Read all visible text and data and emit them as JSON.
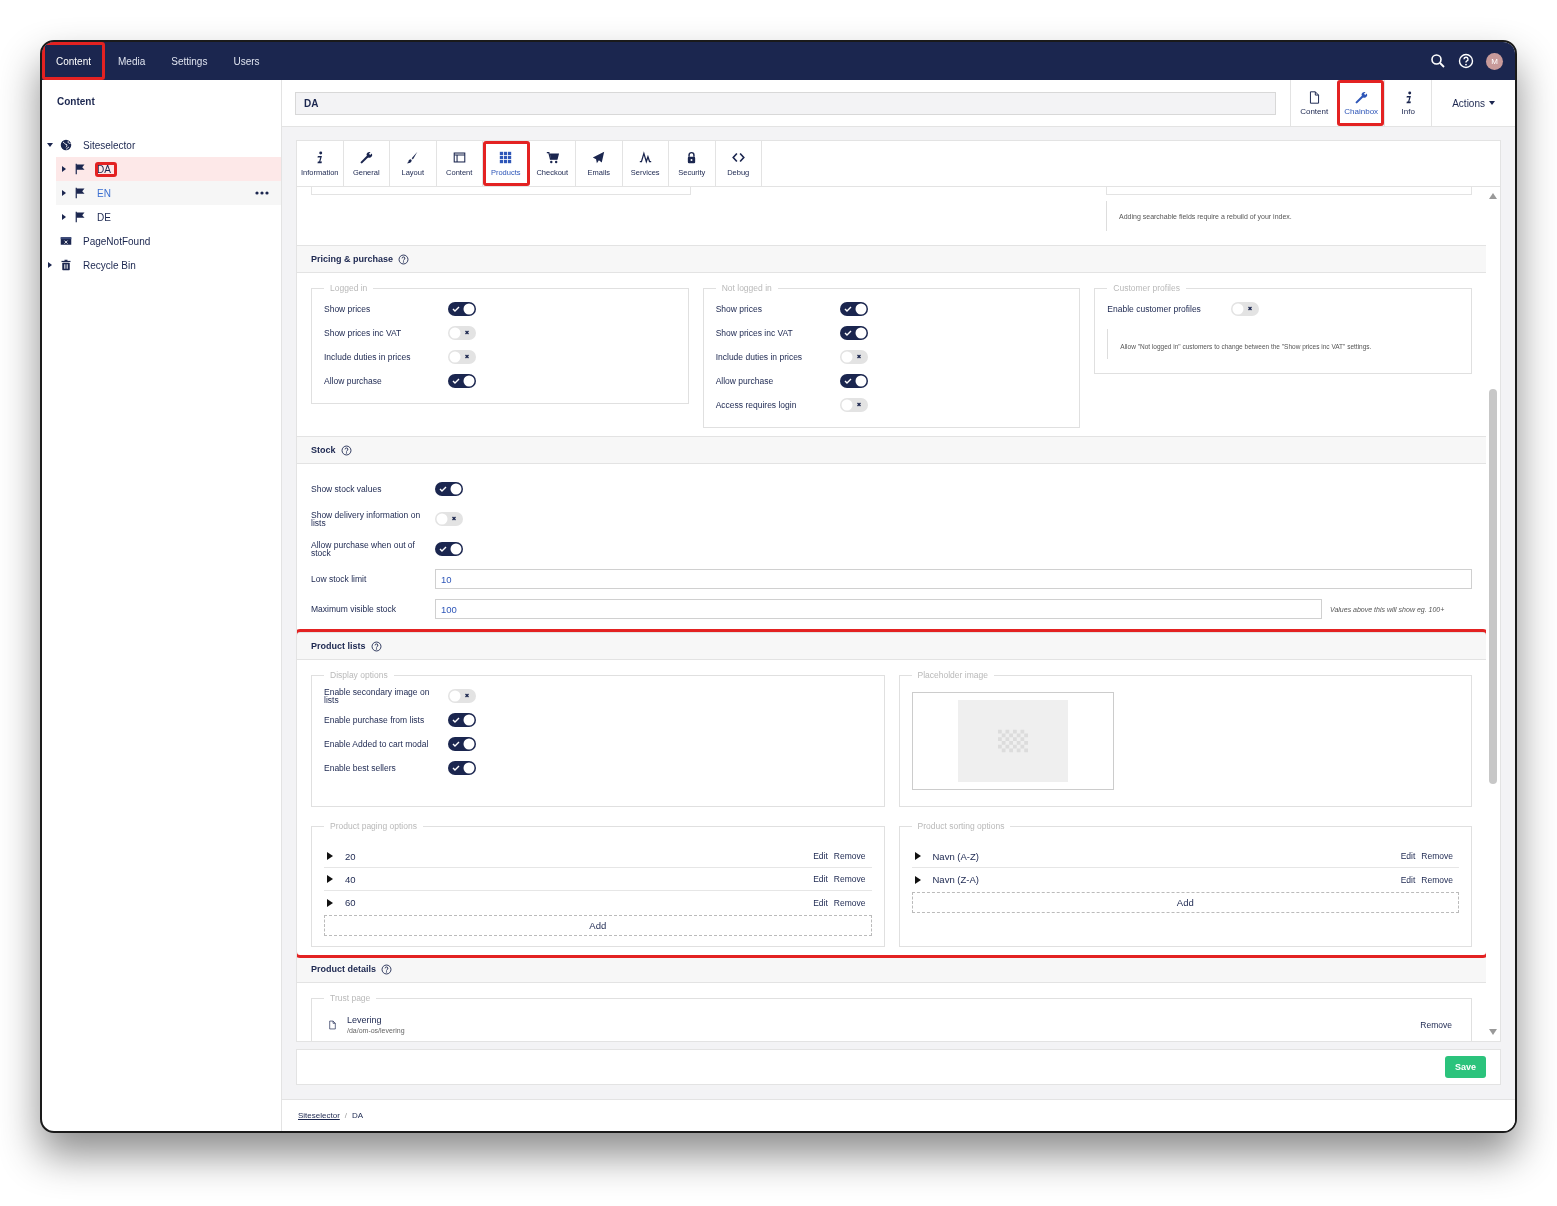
{
  "top_nav": {
    "items": [
      {
        "label": "Content",
        "selected": true,
        "highlighted": true
      },
      {
        "label": "Media",
        "selected": false,
        "highlighted": false
      },
      {
        "label": "Settings",
        "selected": false,
        "highlighted": false
      },
      {
        "label": "Users",
        "selected": false,
        "highlighted": false
      }
    ],
    "avatar": "M"
  },
  "sidebar": {
    "title": "Content",
    "tree": [
      {
        "label": "Siteselector",
        "kind": "site",
        "expanded": true,
        "selected": false,
        "hovered": false,
        "highlighted": false,
        "children": [
          {
            "label": "DA",
            "kind": "language",
            "expanded": false,
            "selected": true,
            "hovered": false,
            "highlighted": true
          },
          {
            "label": "EN",
            "kind": "language",
            "expanded": false,
            "selected": false,
            "hovered": true,
            "highlighted": false
          },
          {
            "label": "DE",
            "kind": "language",
            "expanded": false,
            "selected": false,
            "hovered": false,
            "highlighted": false
          }
        ]
      },
      {
        "label": "PageNotFound",
        "kind": "error-page",
        "selected": false,
        "hovered": false,
        "highlighted": false
      },
      {
        "label": "Recycle Bin",
        "kind": "bin",
        "expanded": false,
        "selected": false,
        "hovered": false,
        "highlighted": false
      }
    ]
  },
  "header": {
    "name": "DA",
    "apps": [
      {
        "label": "Content",
        "kind": "document",
        "selected": false,
        "highlighted": false
      },
      {
        "label": "Chainbox",
        "kind": "wrench",
        "selected": true,
        "highlighted": true
      },
      {
        "label": "Info",
        "kind": "info",
        "selected": false,
        "highlighted": false
      }
    ],
    "actions": "Actions"
  },
  "tabs": [
    {
      "label": "Information",
      "kind": "info",
      "selected": false,
      "highlighted": false
    },
    {
      "label": "General",
      "kind": "wrench",
      "selected": false,
      "highlighted": false
    },
    {
      "label": "Layout",
      "kind": "brush",
      "selected": false,
      "highlighted": false
    },
    {
      "label": "Content",
      "kind": "layout",
      "selected": false,
      "highlighted": false
    },
    {
      "label": "Products",
      "kind": "grid",
      "selected": true,
      "highlighted": true
    },
    {
      "label": "Checkout",
      "kind": "cart",
      "selected": false,
      "highlighted": false
    },
    {
      "label": "Emails",
      "kind": "plane",
      "selected": false,
      "highlighted": false
    },
    {
      "label": "Services",
      "kind": "pulse",
      "selected": false,
      "highlighted": false
    },
    {
      "label": "Security",
      "kind": "lock",
      "selected": false,
      "highlighted": false
    },
    {
      "label": "Debug",
      "kind": "code",
      "selected": false,
      "highlighted": false
    }
  ],
  "top_note": "Adding searchable fields require a rebuild of your index.",
  "sections": [
    {
      "kind": "columns",
      "title": "Pricing & purchase",
      "highlighted": false,
      "groups": [
        {
          "legend": "Logged in",
          "items": [
            {
              "kind": "toggle",
              "label": "Show prices",
              "on": true
            },
            {
              "kind": "toggle",
              "label": "Show prices inc VAT",
              "on": false
            },
            {
              "kind": "toggle",
              "label": "Include duties in prices",
              "on": false
            },
            {
              "kind": "toggle",
              "label": "Allow purchase",
              "on": true
            }
          ]
        },
        {
          "legend": "Not logged in",
          "items": [
            {
              "kind": "toggle",
              "label": "Show prices",
              "on": true
            },
            {
              "kind": "toggle",
              "label": "Show prices inc VAT",
              "on": true
            },
            {
              "kind": "toggle",
              "label": "Include duties in prices",
              "on": false
            },
            {
              "kind": "toggle",
              "label": "Allow purchase",
              "on": true
            },
            {
              "kind": "toggle",
              "label": "Access requires login",
              "on": false
            }
          ]
        },
        {
          "legend": "Customer profiles",
          "items": [
            {
              "kind": "toggle",
              "label": "Enable customer profiles",
              "on": false
            },
            {
              "kind": "note",
              "text": "Allow \"Not logged in\" customers to change between the \"Show prices inc VAT\" settings."
            }
          ]
        }
      ]
    },
    {
      "kind": "rows",
      "title": "Stock",
      "highlighted": false,
      "items": [
        {
          "kind": "toggle",
          "label": "Show stock values",
          "on": true
        },
        {
          "kind": "toggle",
          "label": "Show delivery information on lists",
          "on": false
        },
        {
          "kind": "toggle",
          "label": "Allow purchase when out of stock",
          "on": true
        },
        {
          "kind": "input",
          "label": "Low stock limit",
          "value": "10"
        },
        {
          "kind": "input",
          "label": "Maximum visible stock",
          "value": "100",
          "hint": "Values above this will show eg. 100+"
        }
      ]
    },
    {
      "kind": "grid",
      "title": "Product lists",
      "highlighted": true,
      "groups": [
        {
          "legend": "Display options",
          "items": [
            {
              "kind": "toggle",
              "label": "Enable secondary image on lists",
              "on": false
            },
            {
              "kind": "toggle",
              "label": "Enable purchase from lists",
              "on": true
            },
            {
              "kind": "toggle",
              "label": "Enable Added to cart modal",
              "on": true
            },
            {
              "kind": "toggle",
              "label": "Enable best sellers",
              "on": true
            }
          ]
        },
        {
          "legend": "Placeholder image",
          "items": [
            {
              "kind": "image"
            }
          ]
        },
        {
          "legend": "Product paging options",
          "items": [
            {
              "kind": "list",
              "entries": [
                {
                  "label": "20",
                  "edit": "Edit",
                  "remove": "Remove"
                },
                {
                  "label": "40",
                  "edit": "Edit",
                  "remove": "Remove"
                },
                {
                  "label": "60",
                  "edit": "Edit",
                  "remove": "Remove"
                }
              ],
              "add": "Add"
            }
          ]
        },
        {
          "legend": "Product sorting options",
          "items": [
            {
              "kind": "list",
              "entries": [
                {
                  "label": "Navn (A-Z)",
                  "edit": "Edit",
                  "remove": "Remove"
                },
                {
                  "label": "Navn (Z-A)",
                  "edit": "Edit",
                  "remove": "Remove"
                }
              ],
              "add": "Add"
            }
          ]
        }
      ]
    },
    {
      "kind": "wide",
      "title": "Product details",
      "highlighted": false,
      "groups": [
        {
          "legend": "Trust page",
          "items": [
            {
              "kind": "picked",
              "name": "Levering",
              "path": "/da/om-os/levering",
              "remove": "Remove"
            }
          ]
        }
      ]
    }
  ],
  "footer": {
    "save": "Save"
  },
  "breadcrumb": {
    "separator": "/",
    "items": [
      {
        "label": "Siteselector",
        "link": true
      },
      {
        "label": "DA",
        "link": false
      }
    ]
  }
}
